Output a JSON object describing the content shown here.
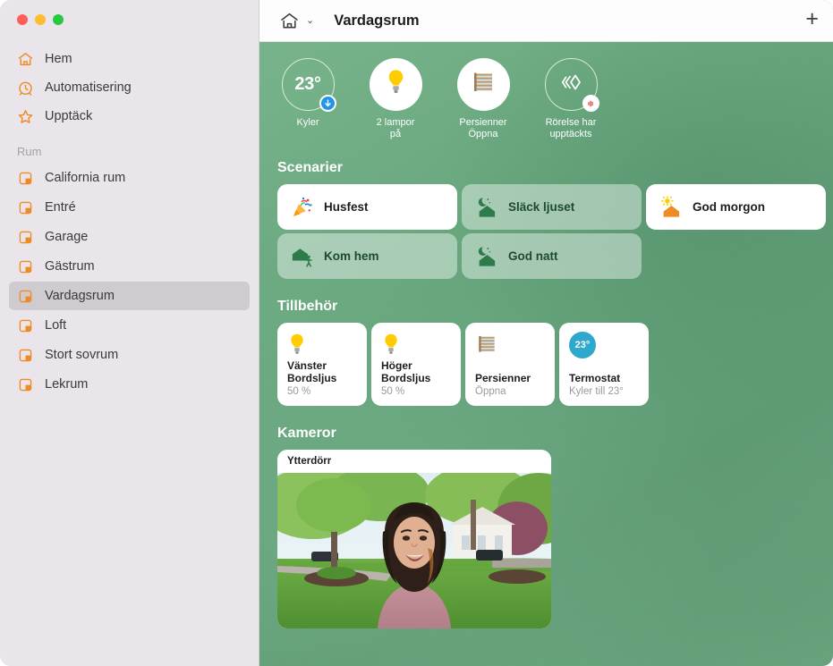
{
  "window": {
    "traffic_lights": [
      {
        "name": "close",
        "color": "#ff5f57"
      },
      {
        "name": "minimize",
        "color": "#febc2e"
      },
      {
        "name": "maximize",
        "color": "#28c840"
      }
    ]
  },
  "sidebar": {
    "primary_items": [
      {
        "label": "Hem",
        "icon": "house-icon"
      },
      {
        "label": "Automatisering",
        "icon": "clock-icon"
      },
      {
        "label": "Upptäck",
        "icon": "star-icon"
      }
    ],
    "section_title": "Rum",
    "rooms": [
      {
        "label": "California rum",
        "icon": "room-icon",
        "selected": false
      },
      {
        "label": "Entré",
        "icon": "room-icon",
        "selected": false
      },
      {
        "label": "Garage",
        "icon": "room-icon",
        "selected": false
      },
      {
        "label": "Gästrum",
        "icon": "room-icon",
        "selected": false
      },
      {
        "label": "Vardagsrum",
        "icon": "room-icon",
        "selected": true
      },
      {
        "label": "Loft",
        "icon": "room-icon",
        "selected": false
      },
      {
        "label": "Stort sovrum",
        "icon": "room-icon",
        "selected": false
      },
      {
        "label": "Lekrum",
        "icon": "room-icon",
        "selected": false
      }
    ]
  },
  "toolbar": {
    "home_icon": "house-icon",
    "chevron": "⌄",
    "title": "Vardagsrum",
    "add_label": "+"
  },
  "status": [
    {
      "icon": "temperature-value",
      "value": "23°",
      "label": "Kyler",
      "badge": "cooling-arrow-down",
      "style": "outline"
    },
    {
      "icon": "lightbulb-icon",
      "value": "",
      "label": "2 lampor\npå",
      "badge": "",
      "style": "filled"
    },
    {
      "icon": "blinds-icon",
      "value": "",
      "label": "Persienner\nÖppna",
      "badge": "",
      "style": "filled"
    },
    {
      "icon": "motion-sensor-icon",
      "value": "",
      "label": "Rörelse har\nupptäckts",
      "badge": "motion-detected",
      "style": "outline"
    }
  ],
  "scenes": {
    "title": "Scenarier",
    "items": [
      {
        "label": "Husfest",
        "icon": "party-popper-icon",
        "style": "light"
      },
      {
        "label": "Släck ljuset",
        "icon": "moon-house-icon",
        "style": "tint"
      },
      {
        "label": "God morgon",
        "icon": "sun-house-icon",
        "style": "light"
      },
      {
        "label": "Kom hem",
        "icon": "house-person-icon",
        "style": "tint"
      },
      {
        "label": "God natt",
        "icon": "moon-house-icon",
        "style": "tint"
      }
    ]
  },
  "accessories": {
    "title": "Tillbehör",
    "items": [
      {
        "name": "Vänster\nBordsljus",
        "status": "50 %",
        "icon": "lightbulb-icon"
      },
      {
        "name": "Höger\nBordsljus",
        "status": "50 %",
        "icon": "lightbulb-icon"
      },
      {
        "name": "Persienner",
        "status": "Öppna",
        "icon": "blinds-icon"
      },
      {
        "name": "Termostat",
        "status": "Kyler till 23°",
        "icon": "thermostat-icon",
        "badge_value": "23°"
      }
    ]
  },
  "cameras": {
    "title": "Kameror",
    "items": [
      {
        "name": "Ytterdörr"
      }
    ]
  },
  "colors": {
    "accent_orange": "#f08a22",
    "background_green": "#67a67d",
    "cooling_blue": "#2196e8",
    "thermostat_teal": "#2fa8cd",
    "motion_red": "#e8453c"
  }
}
